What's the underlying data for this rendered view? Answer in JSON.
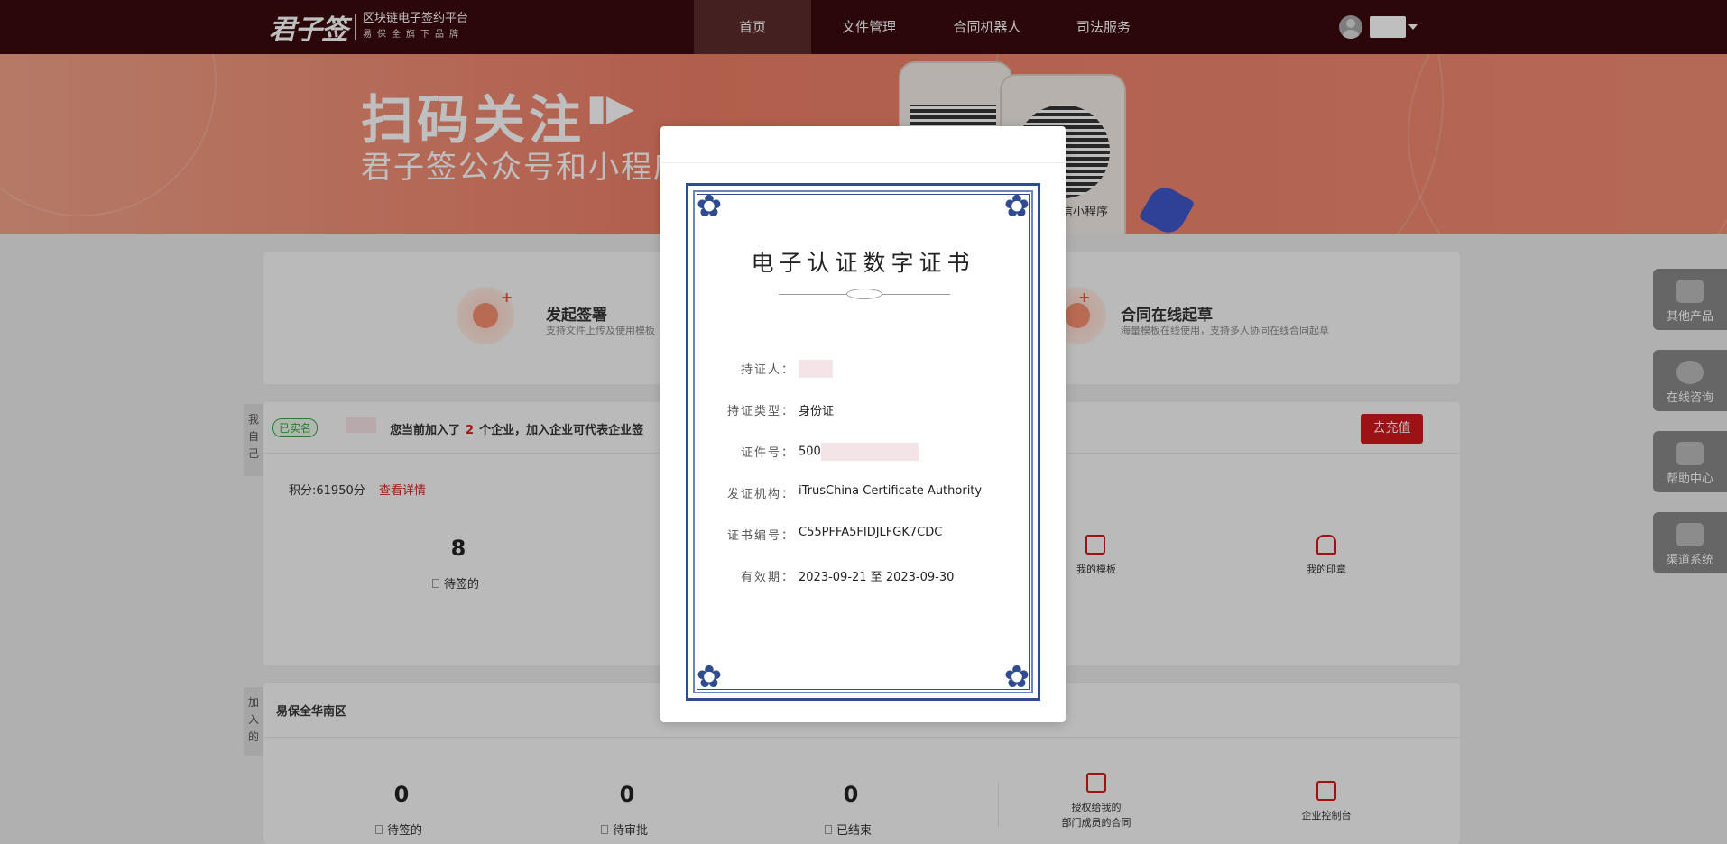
{
  "nav": {
    "brand": "君子签",
    "brand_tagline_1": "区块链电子签约平台",
    "brand_tagline_2": "易保全旗下品牌",
    "items": [
      "首页",
      "文件管理",
      "合同机器人",
      "司法服务"
    ],
    "active": 0
  },
  "banner": {
    "title": "扫码关注",
    "subtitle": "君子签公众号和小程序",
    "caption": "信小程序"
  },
  "quick_actions": [
    {
      "title": "发起签署",
      "desc": "支持文件上传及使用模板"
    },
    {
      "title": "合同在线起草",
      "desc": "海量模板在线使用，支持多人协同在线合同起草"
    }
  ],
  "self_section": {
    "tab": "我自己",
    "verified": "已实名",
    "notice_pre": "您当前加入了",
    "notice_count": "2",
    "notice_post": "个企业，加入企业可代表企业签",
    "recharge": "去充值",
    "points": "积分:61950分",
    "details": "查看详情",
    "pending_count": "8",
    "pending_label": "待签的",
    "tools": [
      "我的模板",
      "我的印章"
    ]
  },
  "company_section": {
    "tab": "加入的",
    "name": "易保全华南区",
    "stats": [
      {
        "num": "0",
        "label": "待签的"
      },
      {
        "num": "0",
        "label": "待审批"
      },
      {
        "num": "0",
        "label": "已结束"
      }
    ],
    "tools": [
      {
        "label1": "授权给我的",
        "label2": "部门成员的合同"
      },
      {
        "label1": "企业控制台",
        "label2": ""
      }
    ]
  },
  "float_menu": [
    "其他产品",
    "在线咨询",
    "帮助中心",
    "渠道系统"
  ],
  "certificate": {
    "title": "电子认证数字证书",
    "fields": [
      {
        "label": "持证人：",
        "value": ""
      },
      {
        "label": "持证类型：",
        "value": "身份证"
      },
      {
        "label": "证件号：",
        "value": "500"
      },
      {
        "label": "发证机构：",
        "value": "iTrusChina Certificate Authority"
      },
      {
        "label": "证书编号：",
        "value": "C55PFFA5FIDJLFGK7CDC"
      },
      {
        "label": "有效期：",
        "value": "2023-09-21 至 2023-09-30"
      }
    ]
  }
}
